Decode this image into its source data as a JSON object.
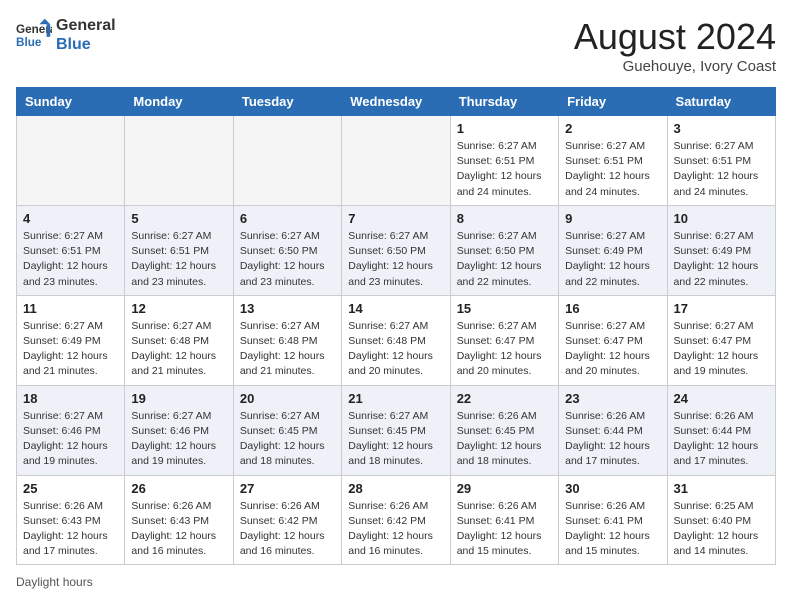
{
  "header": {
    "logo_general": "General",
    "logo_blue": "Blue",
    "month_title": "August 2024",
    "location": "Guehouye, Ivory Coast"
  },
  "footer": {
    "label": "Daylight hours"
  },
  "days_of_week": [
    "Sunday",
    "Monday",
    "Tuesday",
    "Wednesday",
    "Thursday",
    "Friday",
    "Saturday"
  ],
  "weeks": [
    [
      {
        "day": "",
        "info": ""
      },
      {
        "day": "",
        "info": ""
      },
      {
        "day": "",
        "info": ""
      },
      {
        "day": "",
        "info": ""
      },
      {
        "day": "1",
        "info": "Sunrise: 6:27 AM\nSunset: 6:51 PM\nDaylight: 12 hours\nand 24 minutes."
      },
      {
        "day": "2",
        "info": "Sunrise: 6:27 AM\nSunset: 6:51 PM\nDaylight: 12 hours\nand 24 minutes."
      },
      {
        "day": "3",
        "info": "Sunrise: 6:27 AM\nSunset: 6:51 PM\nDaylight: 12 hours\nand 24 minutes."
      }
    ],
    [
      {
        "day": "4",
        "info": "Sunrise: 6:27 AM\nSunset: 6:51 PM\nDaylight: 12 hours\nand 23 minutes."
      },
      {
        "day": "5",
        "info": "Sunrise: 6:27 AM\nSunset: 6:51 PM\nDaylight: 12 hours\nand 23 minutes."
      },
      {
        "day": "6",
        "info": "Sunrise: 6:27 AM\nSunset: 6:50 PM\nDaylight: 12 hours\nand 23 minutes."
      },
      {
        "day": "7",
        "info": "Sunrise: 6:27 AM\nSunset: 6:50 PM\nDaylight: 12 hours\nand 23 minutes."
      },
      {
        "day": "8",
        "info": "Sunrise: 6:27 AM\nSunset: 6:50 PM\nDaylight: 12 hours\nand 22 minutes."
      },
      {
        "day": "9",
        "info": "Sunrise: 6:27 AM\nSunset: 6:49 PM\nDaylight: 12 hours\nand 22 minutes."
      },
      {
        "day": "10",
        "info": "Sunrise: 6:27 AM\nSunset: 6:49 PM\nDaylight: 12 hours\nand 22 minutes."
      }
    ],
    [
      {
        "day": "11",
        "info": "Sunrise: 6:27 AM\nSunset: 6:49 PM\nDaylight: 12 hours\nand 21 minutes."
      },
      {
        "day": "12",
        "info": "Sunrise: 6:27 AM\nSunset: 6:48 PM\nDaylight: 12 hours\nand 21 minutes."
      },
      {
        "day": "13",
        "info": "Sunrise: 6:27 AM\nSunset: 6:48 PM\nDaylight: 12 hours\nand 21 minutes."
      },
      {
        "day": "14",
        "info": "Sunrise: 6:27 AM\nSunset: 6:48 PM\nDaylight: 12 hours\nand 20 minutes."
      },
      {
        "day": "15",
        "info": "Sunrise: 6:27 AM\nSunset: 6:47 PM\nDaylight: 12 hours\nand 20 minutes."
      },
      {
        "day": "16",
        "info": "Sunrise: 6:27 AM\nSunset: 6:47 PM\nDaylight: 12 hours\nand 20 minutes."
      },
      {
        "day": "17",
        "info": "Sunrise: 6:27 AM\nSunset: 6:47 PM\nDaylight: 12 hours\nand 19 minutes."
      }
    ],
    [
      {
        "day": "18",
        "info": "Sunrise: 6:27 AM\nSunset: 6:46 PM\nDaylight: 12 hours\nand 19 minutes."
      },
      {
        "day": "19",
        "info": "Sunrise: 6:27 AM\nSunset: 6:46 PM\nDaylight: 12 hours\nand 19 minutes."
      },
      {
        "day": "20",
        "info": "Sunrise: 6:27 AM\nSunset: 6:45 PM\nDaylight: 12 hours\nand 18 minutes."
      },
      {
        "day": "21",
        "info": "Sunrise: 6:27 AM\nSunset: 6:45 PM\nDaylight: 12 hours\nand 18 minutes."
      },
      {
        "day": "22",
        "info": "Sunrise: 6:26 AM\nSunset: 6:45 PM\nDaylight: 12 hours\nand 18 minutes."
      },
      {
        "day": "23",
        "info": "Sunrise: 6:26 AM\nSunset: 6:44 PM\nDaylight: 12 hours\nand 17 minutes."
      },
      {
        "day": "24",
        "info": "Sunrise: 6:26 AM\nSunset: 6:44 PM\nDaylight: 12 hours\nand 17 minutes."
      }
    ],
    [
      {
        "day": "25",
        "info": "Sunrise: 6:26 AM\nSunset: 6:43 PM\nDaylight: 12 hours\nand 17 minutes."
      },
      {
        "day": "26",
        "info": "Sunrise: 6:26 AM\nSunset: 6:43 PM\nDaylight: 12 hours\nand 16 minutes."
      },
      {
        "day": "27",
        "info": "Sunrise: 6:26 AM\nSunset: 6:42 PM\nDaylight: 12 hours\nand 16 minutes."
      },
      {
        "day": "28",
        "info": "Sunrise: 6:26 AM\nSunset: 6:42 PM\nDaylight: 12 hours\nand 16 minutes."
      },
      {
        "day": "29",
        "info": "Sunrise: 6:26 AM\nSunset: 6:41 PM\nDaylight: 12 hours\nand 15 minutes."
      },
      {
        "day": "30",
        "info": "Sunrise: 6:26 AM\nSunset: 6:41 PM\nDaylight: 12 hours\nand 15 minutes."
      },
      {
        "day": "31",
        "info": "Sunrise: 6:25 AM\nSunset: 6:40 PM\nDaylight: 12 hours\nand 14 minutes."
      }
    ]
  ]
}
